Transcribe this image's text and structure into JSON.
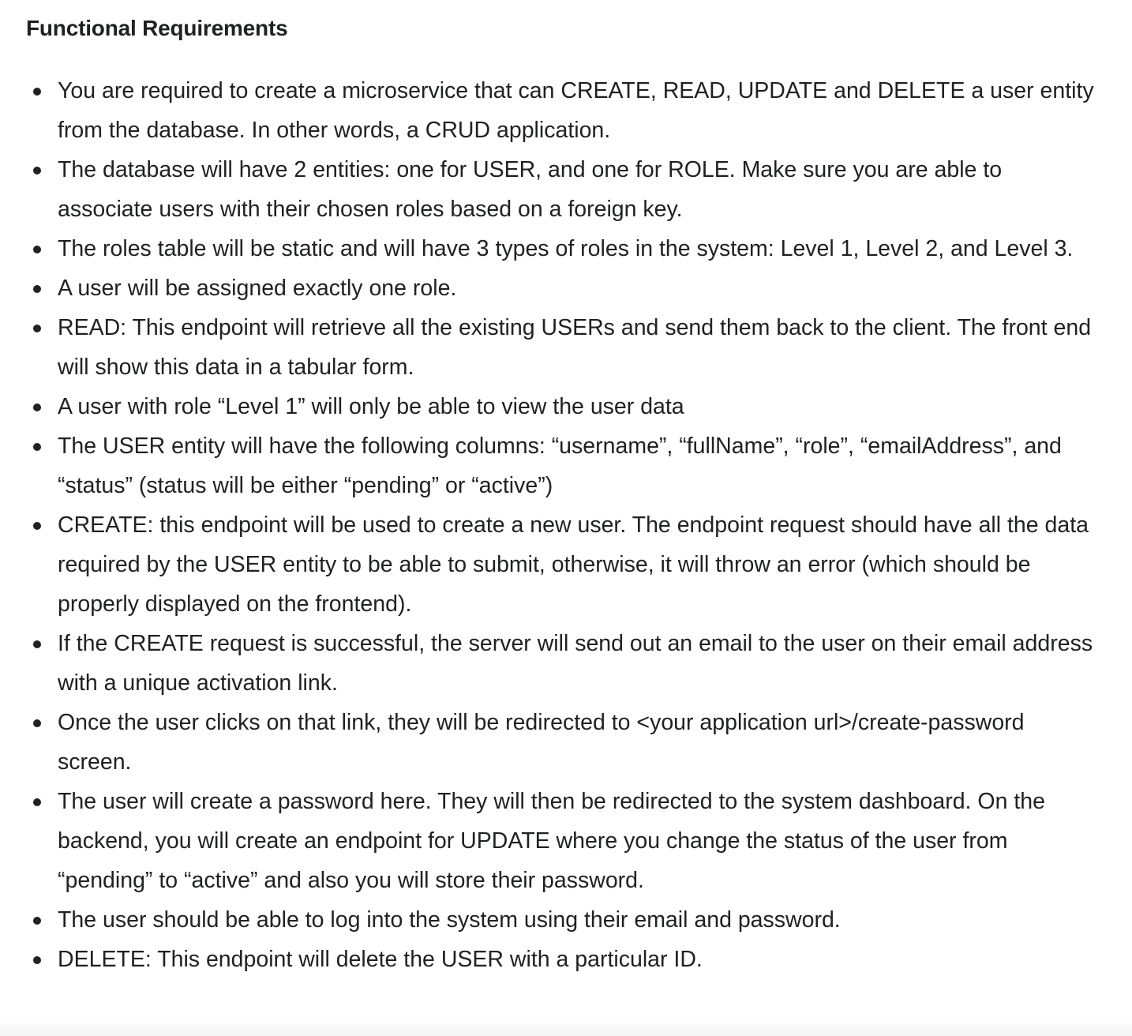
{
  "heading": "Functional Requirements",
  "requirements": [
    "You are required to create a microservice that can CREATE, READ, UPDATE and DELETE a user entity from the database. In other words, a CRUD application.",
    "The database will have 2 entities: one for USER, and one for ROLE. Make sure you are able to associate users with their chosen roles based on a foreign key.",
    "The roles table will be static and will have 3 types of roles in the system: Level 1, Level 2, and Level 3.",
    "A user will be assigned exactly one role.",
    "READ: This endpoint will retrieve all the existing USERs and send them back to the client. The front end will show this data in a tabular form.",
    "A user with role “Level 1” will only be able to view the user data",
    "The USER entity will have the following columns: “username”, “fullName”, “role”, “emailAddress”, and “status” (status will be either “pending” or “active”)",
    "CREATE: this endpoint will be used to create a new user. The endpoint request should have all the data required by the USER entity to be able to submit, otherwise, it will throw an error (which should be properly displayed on the frontend).",
    "If the CREATE request is successful, the server will send out an email to the user on their email address with a unique activation link.",
    "Once the user clicks on that link, they will be redirected to <your application url>/create-password screen.",
    "The user will create a password here. They will then be redirected to the system dashboard. On the backend, you will create an endpoint for UPDATE where you change the status of the user from “pending” to “active” and also you will store their password.",
    "The user should be able to log into the system using their email and password.",
    "DELETE: This endpoint will delete the USER with a particular ID."
  ]
}
